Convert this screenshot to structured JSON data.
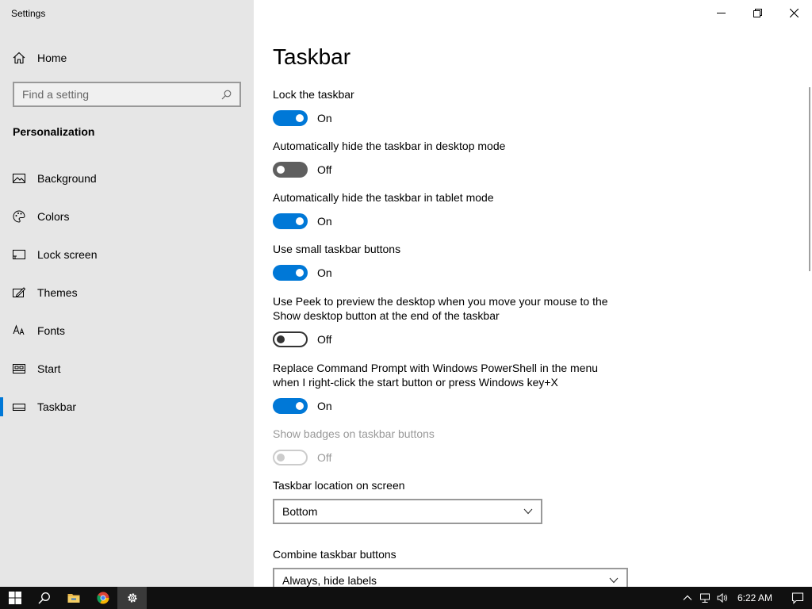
{
  "window": {
    "title": "Settings"
  },
  "sidebar": {
    "home_label": "Home",
    "search_placeholder": "Find a setting",
    "section_title": "Personalization",
    "items": [
      {
        "label": "Background",
        "icon": "picture-icon"
      },
      {
        "label": "Colors",
        "icon": "palette-icon"
      },
      {
        "label": "Lock screen",
        "icon": "lock-screen-icon"
      },
      {
        "label": "Themes",
        "icon": "themes-icon"
      },
      {
        "label": "Fonts",
        "icon": "fonts-icon"
      },
      {
        "label": "Start",
        "icon": "start-icon"
      },
      {
        "label": "Taskbar",
        "icon": "taskbar-icon",
        "active": true
      }
    ]
  },
  "main": {
    "page_title": "Taskbar",
    "settings": [
      {
        "label": "Lock the taskbar",
        "state": "On"
      },
      {
        "label": "Automatically hide the taskbar in desktop mode",
        "state": "Off"
      },
      {
        "label": "Automatically hide the taskbar in tablet mode",
        "state": "On"
      },
      {
        "label": "Use small taskbar buttons",
        "state": "On"
      },
      {
        "label": "Use Peek to preview the desktop when you move your mouse to the Show desktop button at the end of the taskbar",
        "state": "Off"
      },
      {
        "label": "Replace Command Prompt with Windows PowerShell in the menu when I right-click the start button or press Windows key+X",
        "state": "On"
      },
      {
        "label": "Show badges on taskbar buttons",
        "state": "Off",
        "disabled": true
      }
    ],
    "location": {
      "label": "Taskbar location on screen",
      "value": "Bottom"
    },
    "combine": {
      "label": "Combine taskbar buttons",
      "value": "Always, hide labels"
    }
  },
  "taskbar": {
    "clock": "6:22 AM"
  },
  "colors": {
    "accent": "#0078d7",
    "sidebar_bg": "#e6e6e6",
    "taskbar_bg": "#101010"
  }
}
